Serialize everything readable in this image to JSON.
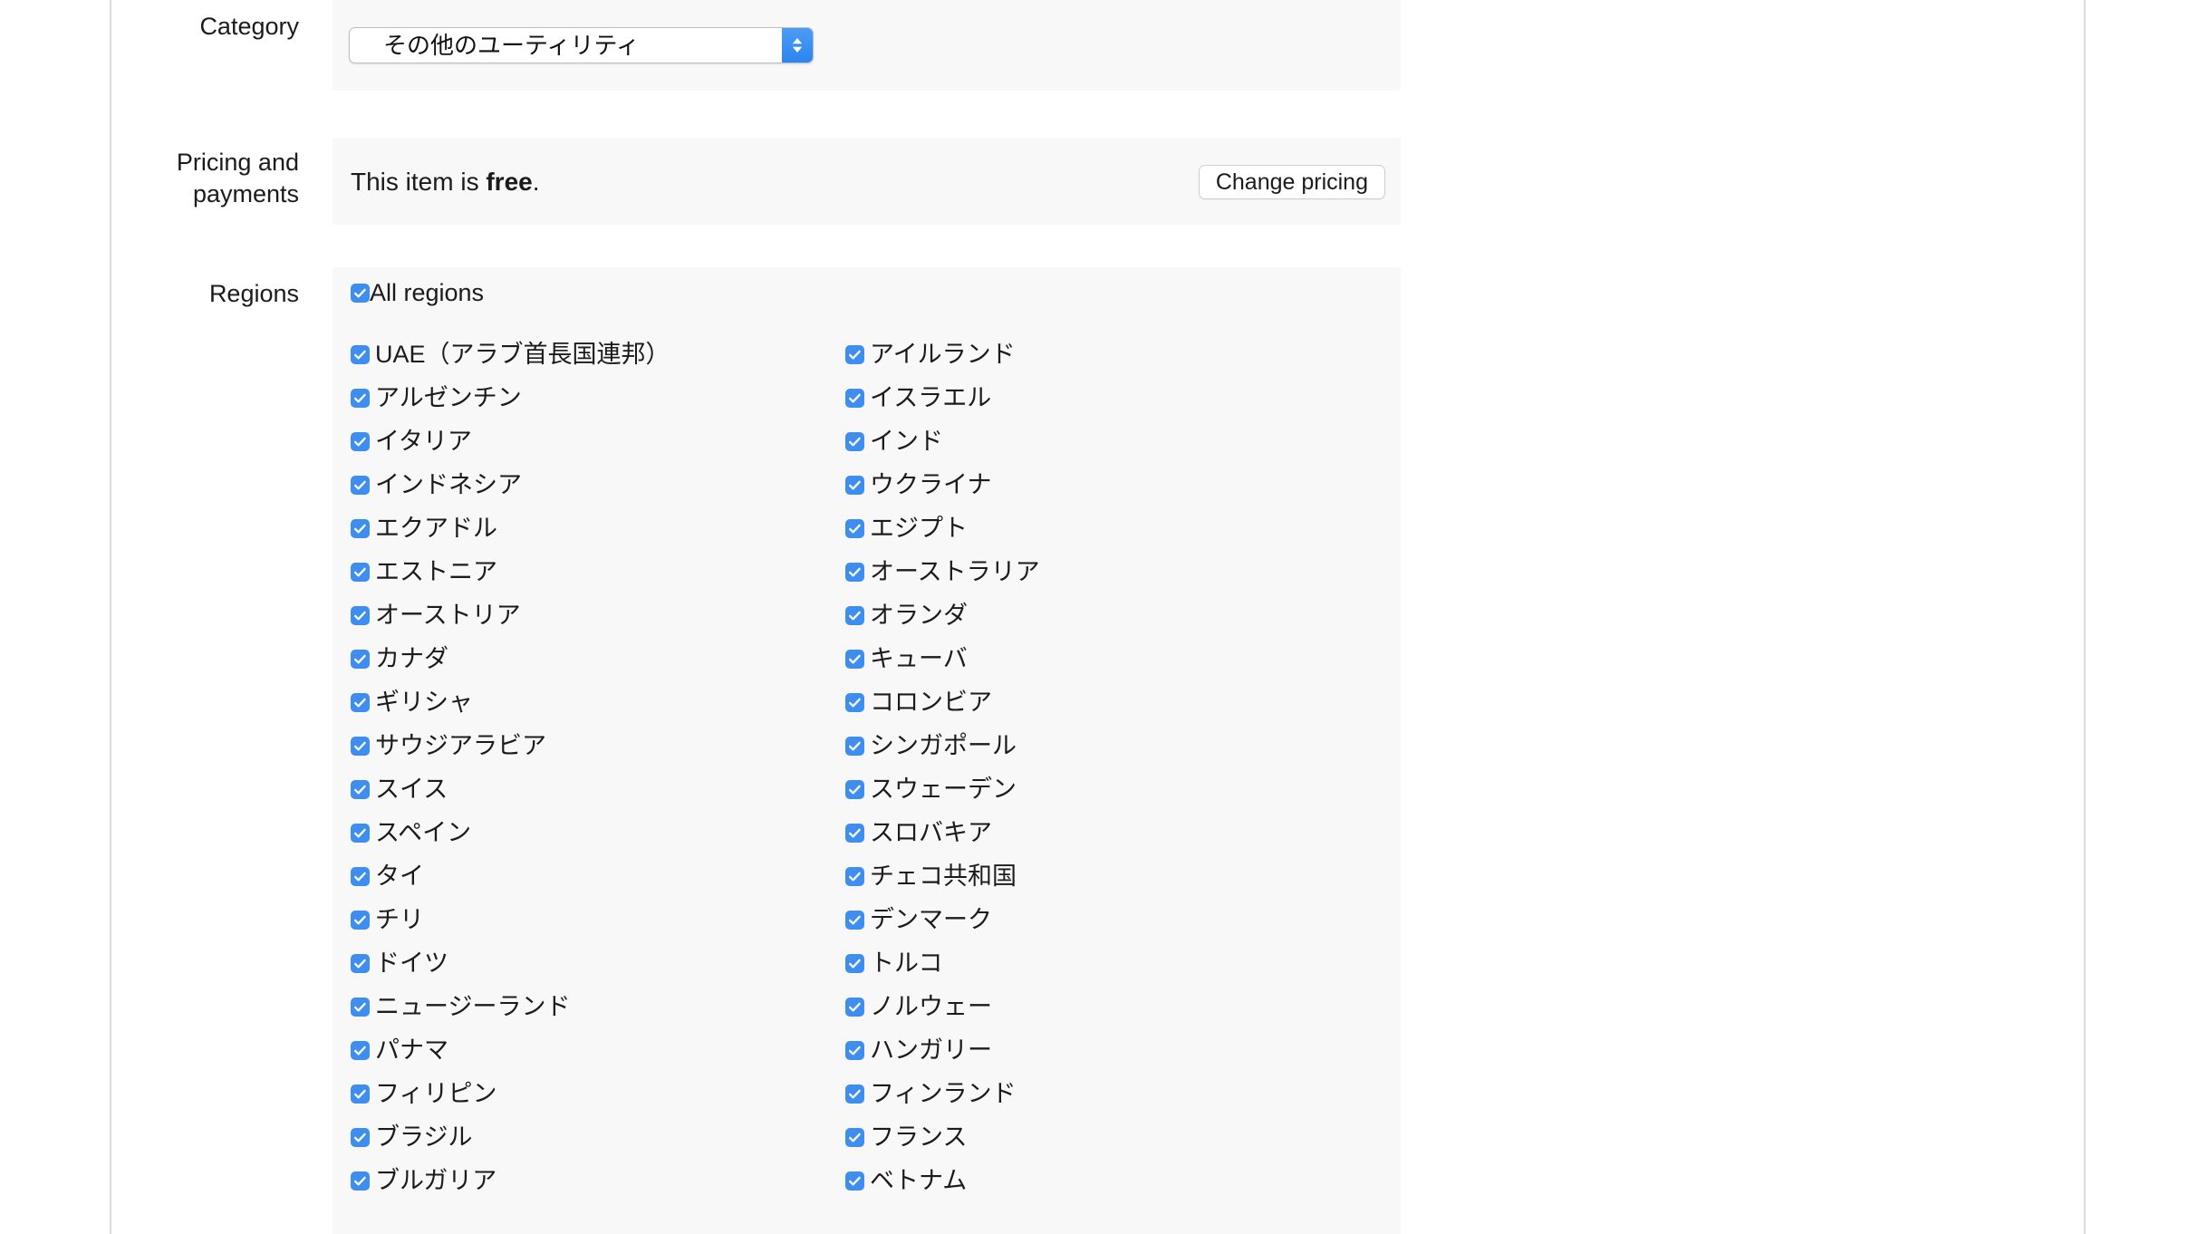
{
  "theme": {
    "accent_blue": "#3e8ef0",
    "panel_bg": "#f8f8f8",
    "page_bg": "#ffffff",
    "rule_color": "#dcdcdc",
    "text_color": "#1b1b1b"
  },
  "category": {
    "label": "Category",
    "select_value": "その他のユーティリティ",
    "arrow_icon": "chevron-up-down-icon"
  },
  "pricing": {
    "label": "Pricing and payments",
    "label_line1": "Pricing and",
    "label_line2": "payments",
    "status_prefix": "This item is ",
    "status_value": "free",
    "status_suffix": ".",
    "change_button": "Change pricing"
  },
  "regions": {
    "label": "Regions",
    "all_regions_label": "All regions",
    "all_regions_checked": true,
    "checkbox_icon": "checkmark-icon",
    "left_column": [
      "UAE（アラブ首長国連邦）",
      "アルゼンチン",
      "イタリア",
      "インドネシア",
      "エクアドル",
      "エストニア",
      "オーストリア",
      "カナダ",
      "ギリシャ",
      "サウジアラビア",
      "スイス",
      "スペイン",
      "タイ",
      "チリ",
      "ドイツ",
      "ニュージーランド",
      "パナマ",
      "フィリピン",
      "ブラジル",
      "ブルガリア"
    ],
    "right_column": [
      "アイルランド",
      "イスラエル",
      "インド",
      "ウクライナ",
      "エジプト",
      "オーストラリア",
      "オランダ",
      "キューバ",
      "コロンビア",
      "シンガポール",
      "スウェーデン",
      "スロバキア",
      "チェコ共和国",
      "デンマーク",
      "トルコ",
      "ノルウェー",
      "ハンガリー",
      "フィンランド",
      "フランス",
      "ベトナム"
    ]
  }
}
